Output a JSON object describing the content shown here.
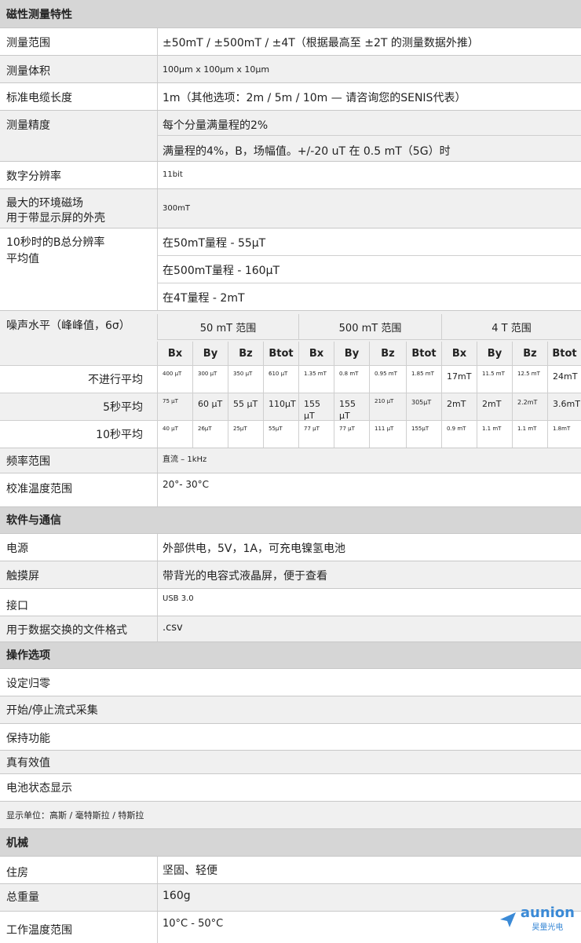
{
  "sections": {
    "magnetic": "磁性测量特性",
    "software": "软件与通信",
    "operation": "操作选项",
    "mechanical": "机械"
  },
  "specs": {
    "range_label": "测量范围",
    "range_value": "±50mT / ±500mT / ±4T（根据最高至 ±2T 的测量数据外推）",
    "volume_label": "测量体积",
    "volume_value": "100μm x 100μm x 10μm",
    "cable_label": "标准电缆长度",
    "cable_value": "1m（其他选项：2m / 5m / 10m — 请咨询您的SENIS代表）",
    "accuracy_label": "测量精度",
    "accuracy_value_1": "每个分量满量程的2%",
    "accuracy_value_2": "满量程的4%，B，场幅值。+/-20 uT 在 0.5 mT（5G）时",
    "resolution_label": "数字分辨率",
    "resolution_value": "11bit",
    "ambient_label_1": "最大的环境磁场",
    "ambient_label_2": "用于带显示屏的外壳",
    "ambient_value": "300mT",
    "avg_label_1": "10秒时的B总分辨率",
    "avg_label_2": "平均值",
    "avg_value_1": "在50mT量程 - 55μT",
    "avg_value_2": "在500mT量程 - 160μT",
    "avg_value_3": "在4T量程 - 2mT"
  },
  "noise": {
    "label": "噪声水平（峰峰值，6σ）",
    "ranges": [
      "50 mT 范围",
      "500 mT 范围",
      "4 T 范围"
    ],
    "columns": [
      "Bx",
      "By",
      "Bz",
      "Btot",
      "Bx",
      "By",
      "Bz",
      "Btot",
      "Bx",
      "By",
      "Bz",
      "Btot"
    ],
    "rows": [
      {
        "label": "不进行平均",
        "values": [
          "400 μT",
          "300 μT",
          "350 μT",
          "610 μT",
          "1.35 mT",
          "0.8 mT",
          "0.95 mT",
          "1.85 mT",
          "17mT",
          "11.5 mT",
          "12.5 mT",
          "24mT"
        ]
      },
      {
        "label": "5秒平均",
        "values": [
          "75 μT",
          "60 μT",
          "55 μT",
          "110μT",
          "155 μT",
          "155 μT",
          "210 μT",
          "305μT",
          "2mT",
          "2mT",
          "2.2mT",
          "3.6mT"
        ]
      },
      {
        "label": "10秒平均",
        "values": [
          "40 μT",
          "26μT",
          "25μT",
          "55μT",
          "77 μT",
          "77 μT",
          "111 μT",
          "155μT",
          "0.9 mT",
          "1.1 mT",
          "1.1 mT",
          "1.8mT"
        ]
      }
    ]
  },
  "freq": {
    "label": "频率范围",
    "value": "直流 – 1kHz"
  },
  "calib": {
    "label": "校准温度范围",
    "value": "20°- 30°C"
  },
  "software": {
    "power_label": "电源",
    "power_value": "外部供电，5V，1A，可充电镍氢电池",
    "touch_label": "触摸屏",
    "touch_value": "带背光的电容式液晶屏，便于查看",
    "port_label": "接口",
    "port_value": "USB 3.0",
    "format_label": "用于数据交换的文件格式",
    "format_value": ".csv"
  },
  "operation": {
    "items": [
      "设定归零",
      "开始/停止流式采集",
      "保持功能",
      "真有效值",
      "电池状态显示",
      "显示单位：高斯 / 毫特斯拉 / 特斯拉"
    ]
  },
  "mechanical": {
    "housing_label": "住房",
    "housing_value": "坚固、轻便",
    "weight_label": "总重量",
    "weight_value": "160g",
    "temp_label": "工作温度范围",
    "temp_value": "10°C - 50°C"
  },
  "logo": {
    "name": "aunion",
    "sub": "昊量光电",
    "color": "#3b8ad6"
  }
}
